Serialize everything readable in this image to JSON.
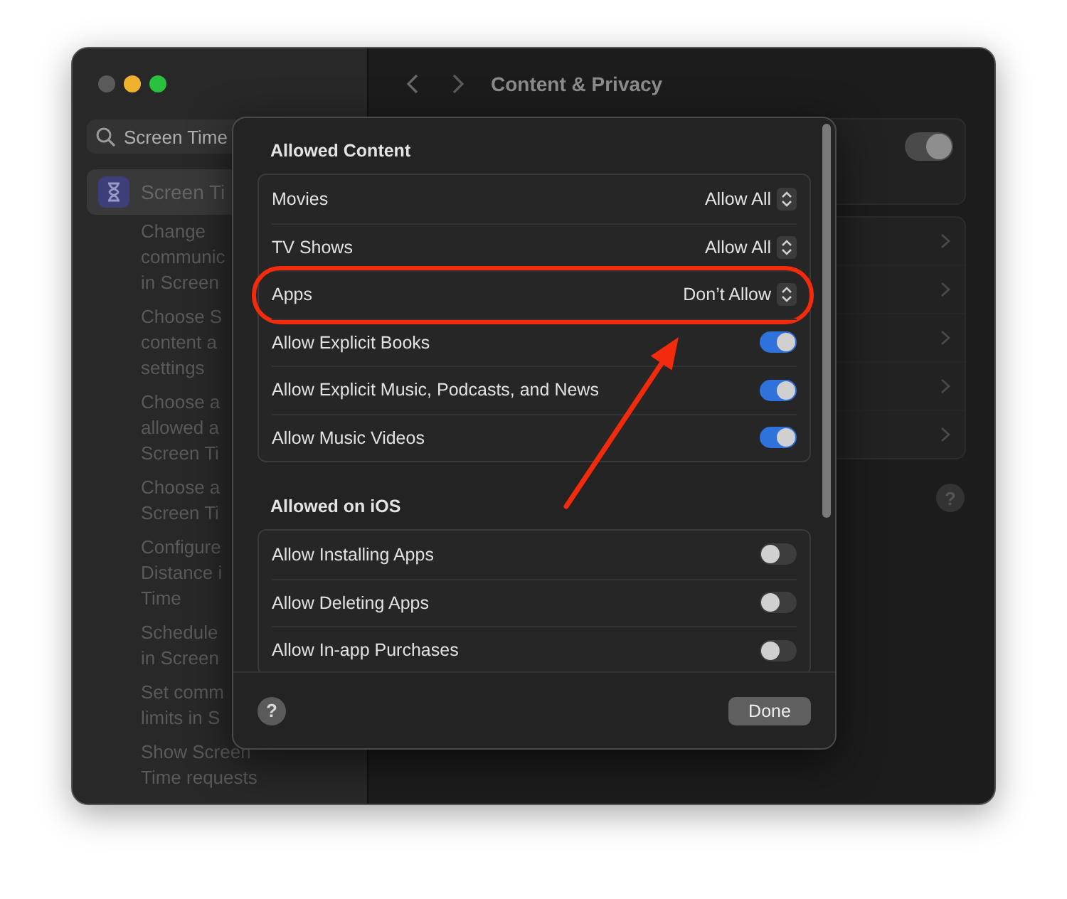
{
  "sidebar": {
    "search": {
      "value": "Screen Time"
    },
    "items": [
      {
        "label": "Screen Ti",
        "selected": true
      }
    ],
    "subitems": [
      {
        "lines": [
          "Change",
          "communic",
          "in Screen"
        ]
      },
      {
        "lines": [
          "Choose S",
          "content a",
          "settings"
        ]
      },
      {
        "lines": [
          "Choose a",
          "allowed a",
          "Screen Ti"
        ]
      },
      {
        "lines": [
          "Choose a",
          "Screen Ti"
        ]
      },
      {
        "lines": [
          "Configure",
          "Distance i",
          "Time"
        ]
      },
      {
        "lines": [
          "Schedule",
          "in Screen"
        ]
      },
      {
        "lines": [
          "Set comm",
          "limits in S"
        ]
      },
      {
        "lines": [
          "Show Screen",
          "Time requests"
        ]
      }
    ]
  },
  "toolbar": {
    "title": "Content & Privacy"
  },
  "main": {
    "switch": {
      "on": true
    },
    "help": "?"
  },
  "sheet": {
    "sections": [
      {
        "title": "Allowed Content",
        "rows": [
          {
            "kind": "popup",
            "label": "Movies",
            "value": "Allow All",
            "highlighted": false
          },
          {
            "kind": "popup",
            "label": "TV Shows",
            "value": "Allow All",
            "highlighted": false
          },
          {
            "kind": "popup",
            "label": "Apps",
            "value": "Don’t Allow",
            "highlighted": true
          },
          {
            "kind": "switch",
            "label": "Allow Explicit Books",
            "on": true,
            "highlighted": false
          },
          {
            "kind": "switch",
            "label": "Allow Explicit Music, Podcasts, and News",
            "on": true,
            "highlighted": false
          },
          {
            "kind": "switch",
            "label": "Allow Music Videos",
            "on": true,
            "highlighted": false
          }
        ]
      },
      {
        "title": "Allowed on iOS",
        "rows": [
          {
            "kind": "switch",
            "label": "Allow Installing Apps",
            "on": false,
            "highlighted": false
          },
          {
            "kind": "switch",
            "label": "Allow Deleting Apps",
            "on": false,
            "highlighted": false
          },
          {
            "kind": "switch",
            "label": "Allow In-app Purchases",
            "on": false,
            "highlighted": false
          }
        ]
      }
    ],
    "help": "?",
    "done": "Done"
  }
}
